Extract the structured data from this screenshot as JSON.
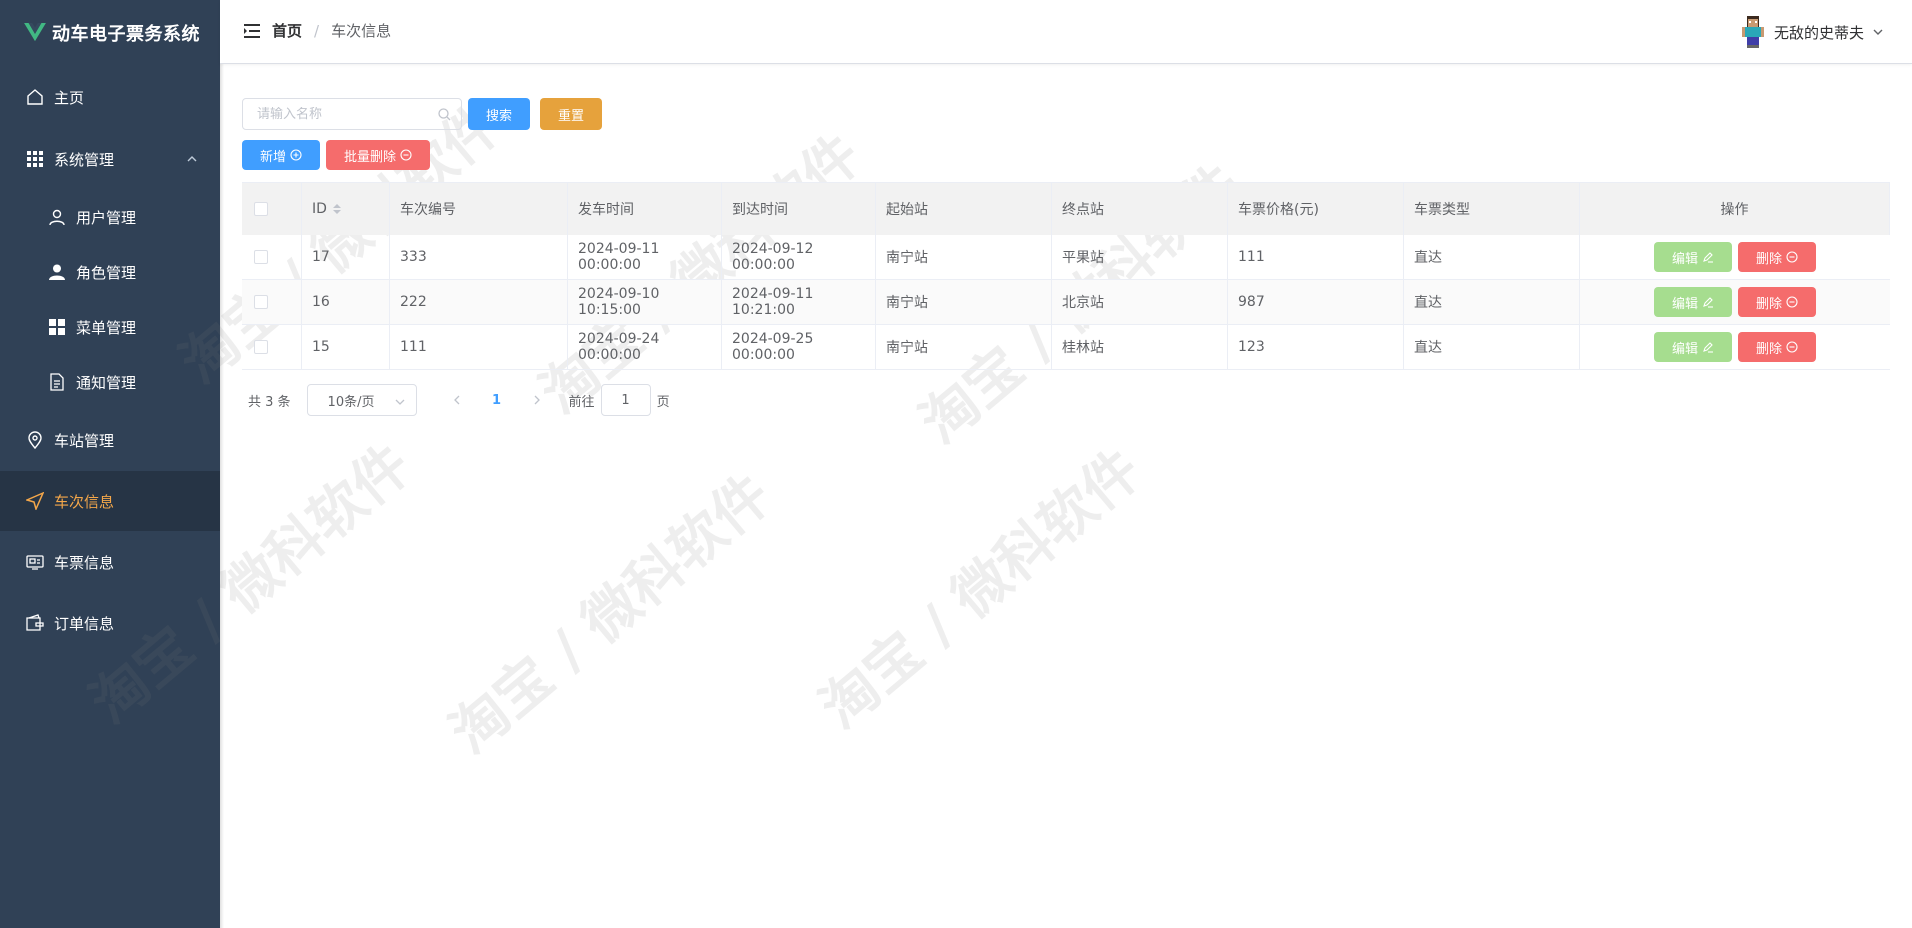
{
  "app": {
    "title": "动车电子票务系统",
    "brand_color": "#41b883"
  },
  "colors": {
    "sidebar_bg": "#304156",
    "active_bg": "#263445",
    "active_text": "#f4a74a",
    "primary": "#409eff",
    "warning": "#e6a23c",
    "danger": "#f56c6c",
    "success_light": "#a6dd8f"
  },
  "sidebar": {
    "items": [
      {
        "label": "主页",
        "icon": "home-icon"
      },
      {
        "label": "系统管理",
        "icon": "grid-icon",
        "expanded": true
      },
      {
        "label": "用户管理",
        "icon": "user-icon"
      },
      {
        "label": "角色管理",
        "icon": "person-filled-icon"
      },
      {
        "label": "菜单管理",
        "icon": "menu-grid-icon"
      },
      {
        "label": "通知管理",
        "icon": "document-icon"
      },
      {
        "label": "车站管理",
        "icon": "location-icon"
      },
      {
        "label": "车次信息",
        "icon": "navigation-icon",
        "active": true
      },
      {
        "label": "车票信息",
        "icon": "ticket-icon"
      },
      {
        "label": "订单信息",
        "icon": "wallet-icon"
      }
    ]
  },
  "header": {
    "breadcrumb": [
      "首页",
      "车次信息"
    ],
    "breadcrumb_sep": "/",
    "username": "无敌的史蒂夫"
  },
  "toolbar": {
    "search_placeholder": "请输入名称",
    "search_value": "",
    "search_label": "搜索",
    "reset_label": "重置",
    "add_label": "新增",
    "batch_delete_label": "批量删除"
  },
  "table": {
    "columns": [
      "ID",
      "车次编号",
      "发车时间",
      "到达时间",
      "起始站",
      "终点站",
      "车票价格(元)",
      "车票类型",
      "操作"
    ],
    "rows": [
      {
        "id": "17",
        "no": "333",
        "dep": "2024-09-11 00:00:00",
        "arr": "2024-09-12 00:00:00",
        "from": "南宁站",
        "to": "平果站",
        "price": "111",
        "type": "直达"
      },
      {
        "id": "16",
        "no": "222",
        "dep": "2024-09-10 10:15:00",
        "arr": "2024-09-11 10:21:00",
        "from": "南宁站",
        "to": "北京站",
        "price": "987",
        "type": "直达"
      },
      {
        "id": "15",
        "no": "111",
        "dep": "2024-09-24 00:00:00",
        "arr": "2024-09-25 00:00:00",
        "from": "南宁站",
        "to": "桂林站",
        "price": "123",
        "type": "直达"
      }
    ],
    "edit_label": "编辑",
    "delete_label": "删除"
  },
  "pagination": {
    "total_text": "共 3 条",
    "page_size": "10条/页",
    "current_page": "1",
    "goto_label": "前往",
    "goto_value": "1",
    "page_suffix": "页"
  },
  "watermark": "淘宝 / 微科软件"
}
